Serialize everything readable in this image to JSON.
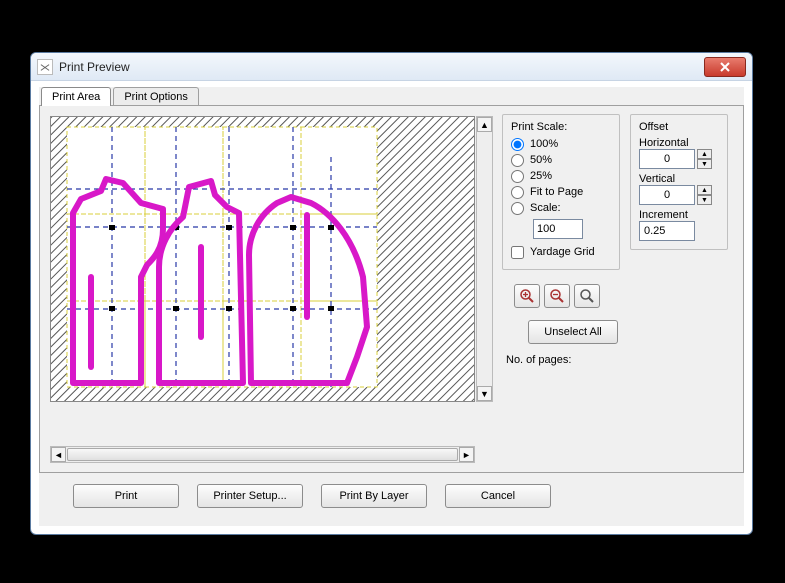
{
  "window": {
    "title": "Print Preview"
  },
  "tabs": {
    "items": [
      {
        "label": "Print Area"
      },
      {
        "label": "Print Options"
      }
    ],
    "active": 0
  },
  "scale": {
    "title": "Print Scale:",
    "options": {
      "p100": "100%",
      "p50": "50%",
      "p25": "25%",
      "fit": "Fit to Page",
      "custom": "Scale:"
    },
    "selected": "p100",
    "custom_value": "100",
    "yardage_label": "Yardage Grid",
    "yardage_checked": false
  },
  "offset": {
    "title": "Offset",
    "h_label": "Horizontal",
    "h_value": "0",
    "v_label": "Vertical",
    "v_value": "0",
    "inc_label": "Increment",
    "inc_value": "0.25"
  },
  "zoom": {
    "in_icon": "zoom-in-icon",
    "out_icon": "zoom-out-icon",
    "fit_icon": "zoom-fit-icon"
  },
  "unselect_label": "Unselect All",
  "pages_label": "No. of pages:",
  "buttons": {
    "print": "Print",
    "setup": "Printer Setup...",
    "by_layer": "Print By Layer",
    "cancel": "Cancel"
  },
  "preview": {
    "accent_color": "#d818c8",
    "grid_color": "#2838a8",
    "tile_color": "#d9cf3b",
    "hatch_color": "#555555"
  }
}
